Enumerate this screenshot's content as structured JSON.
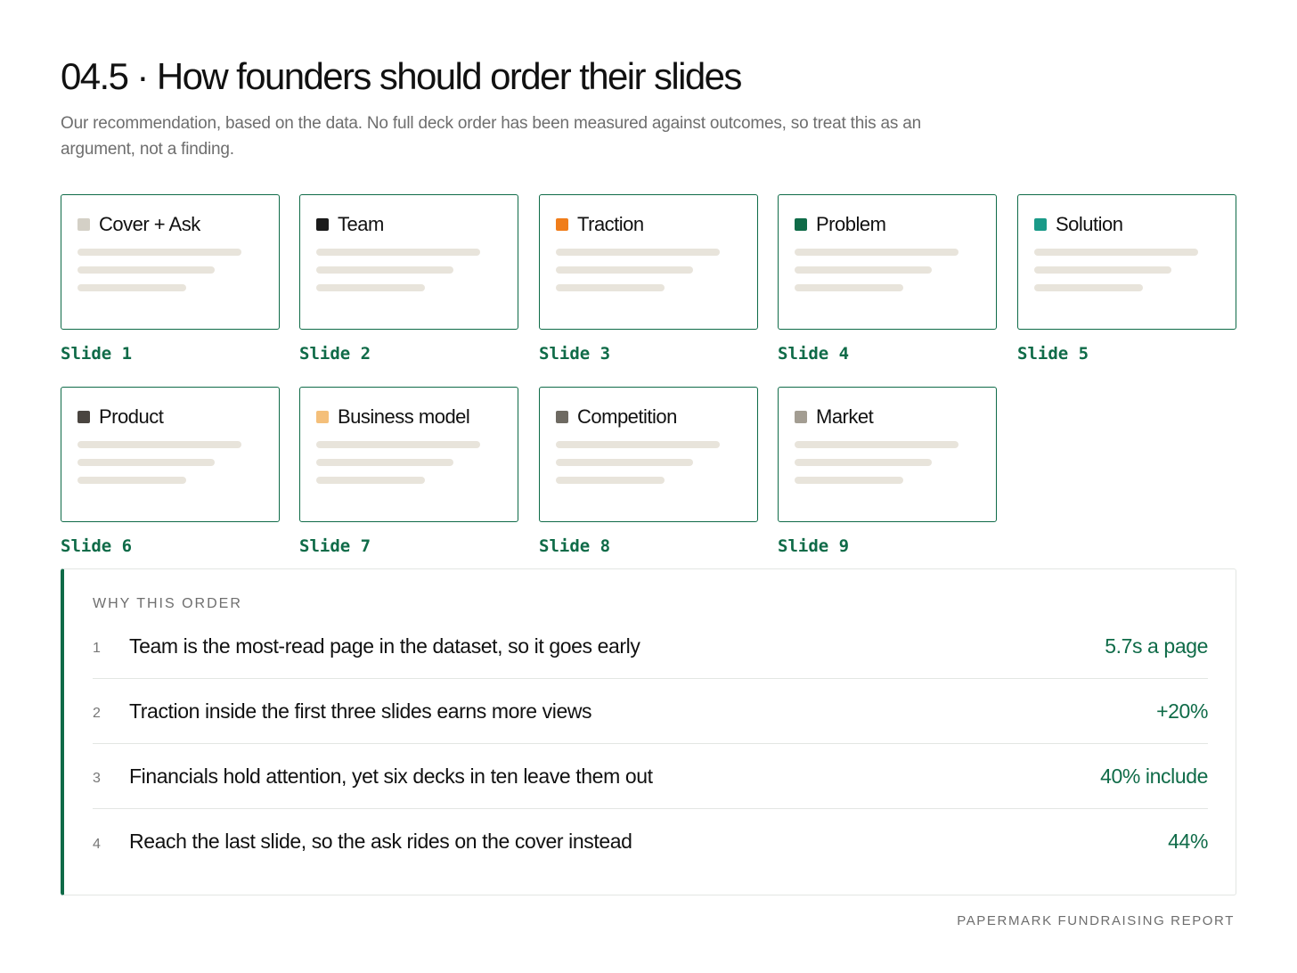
{
  "header": {
    "title": "04.5 · How founders should order their slides",
    "subtitle": "Our recommendation, based on the data. No full deck order has been measured against outcomes, so treat this as an argument, not a finding."
  },
  "slides": [
    {
      "title": "Cover + Ask",
      "label": "Slide 1",
      "color": "#d4d0c6"
    },
    {
      "title": "Team",
      "label": "Slide 2",
      "color": "#1a1a1a"
    },
    {
      "title": "Traction",
      "label": "Slide 3",
      "color": "#f07d1a"
    },
    {
      "title": "Problem",
      "label": "Slide 4",
      "color": "#0f6b48"
    },
    {
      "title": "Solution",
      "label": "Slide 5",
      "color": "#1a9a88"
    },
    {
      "title": "Product",
      "label": "Slide 6",
      "color": "#4a4540"
    },
    {
      "title": "Business model",
      "label": "Slide 7",
      "color": "#f4bf7a"
    },
    {
      "title": "Competition",
      "label": "Slide 8",
      "color": "#6e6a62"
    },
    {
      "title": "Market",
      "label": "Slide 9",
      "color": "#a39d92"
    }
  ],
  "why": {
    "heading": "WHY THIS ORDER",
    "items": [
      {
        "num": "1",
        "text": "Team is the most-read page in the dataset, so it goes early",
        "value": "5.7s a page"
      },
      {
        "num": "2",
        "text": "Traction inside the first three slides earns more views",
        "value": "+20%"
      },
      {
        "num": "3",
        "text": "Financials hold attention, yet six decks in ten leave them out",
        "value": "40% include"
      },
      {
        "num": "4",
        "text": "Reach the last slide, so the ask rides on the cover instead",
        "value": "44%"
      }
    ]
  },
  "footer": "PAPERMARK FUNDRAISING REPORT",
  "colors": {
    "accent": "#0f6b48",
    "placeholder_bar": "#e8e4db"
  }
}
